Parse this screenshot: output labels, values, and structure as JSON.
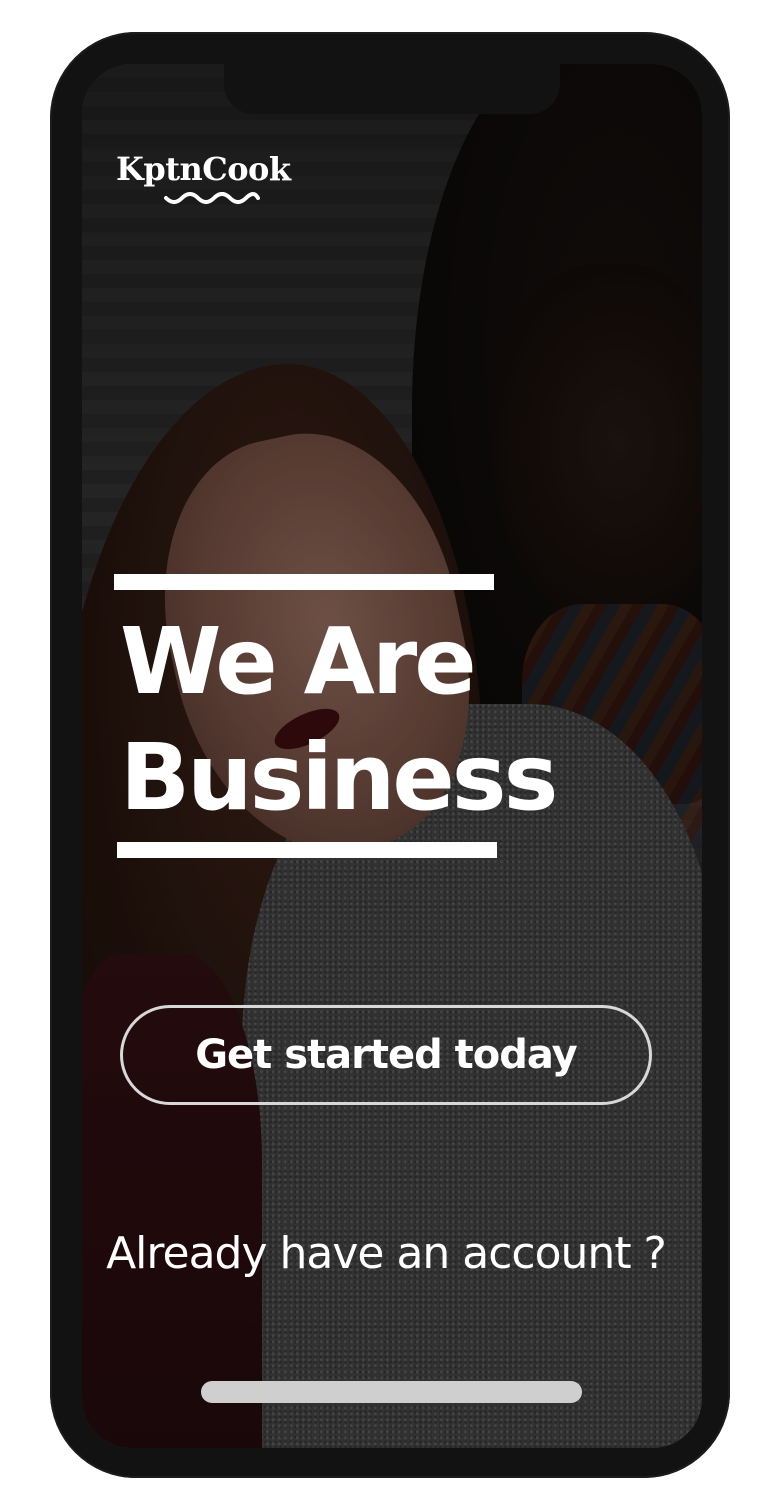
{
  "app": {
    "logo_text": "KptnCook"
  },
  "hero": {
    "headline_line1": "We Are",
    "headline_line2": "Business"
  },
  "actions": {
    "get_started_label": "Get started today",
    "login_link_label": "Already have an account ?"
  },
  "colors": {
    "text": "#ffffff",
    "button_border": "#d8d8d8",
    "device_frame": "#121212",
    "home_indicator": "#cfcfcf"
  },
  "icons": {
    "logo_wave": "wave-underline-icon"
  }
}
